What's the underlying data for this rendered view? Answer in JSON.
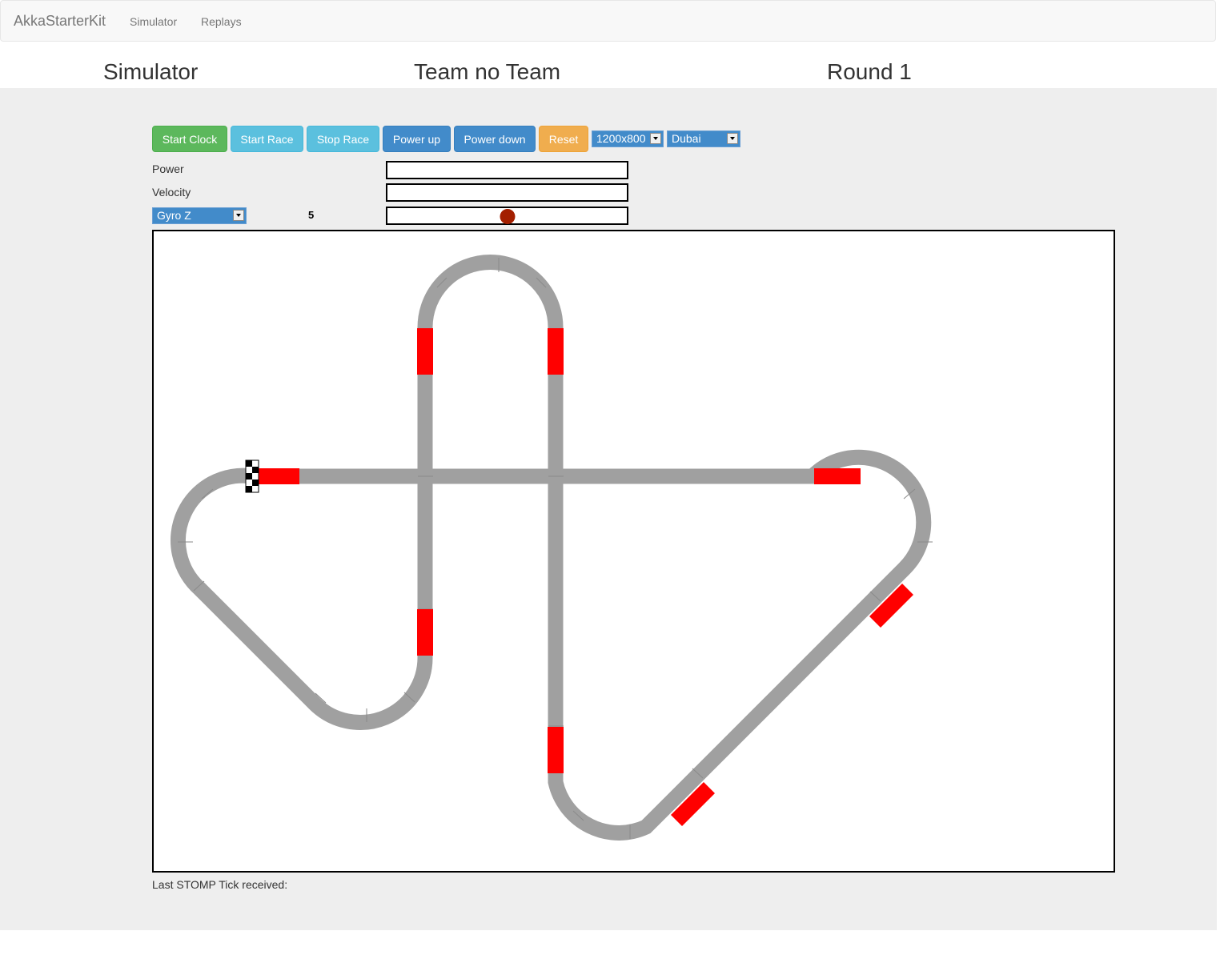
{
  "navbar": {
    "brand": "AkkaStarterKit",
    "links": [
      "Simulator",
      "Replays"
    ]
  },
  "header": {
    "title": "Simulator",
    "team": "Team no Team",
    "round": "Round 1"
  },
  "toolbar": {
    "start_clock": "Start Clock",
    "start_race": "Start Race",
    "stop_race": "Stop Race",
    "power_up": "Power up",
    "power_down": "Power down",
    "reset": "Reset",
    "resolution": "1200x800",
    "track": "Dubai"
  },
  "sensors": {
    "power_label": "Power",
    "velocity_label": "Velocity",
    "sensor_select": "Gyro Z",
    "sensor_value": "5",
    "gyro_indicator_fraction": 0.5
  },
  "footer": {
    "stomp_label": "Last STOMP Tick received:"
  },
  "colors": {
    "track": "#a0a0a0",
    "curb": "#ff0000",
    "indicator": "#a31f00"
  }
}
